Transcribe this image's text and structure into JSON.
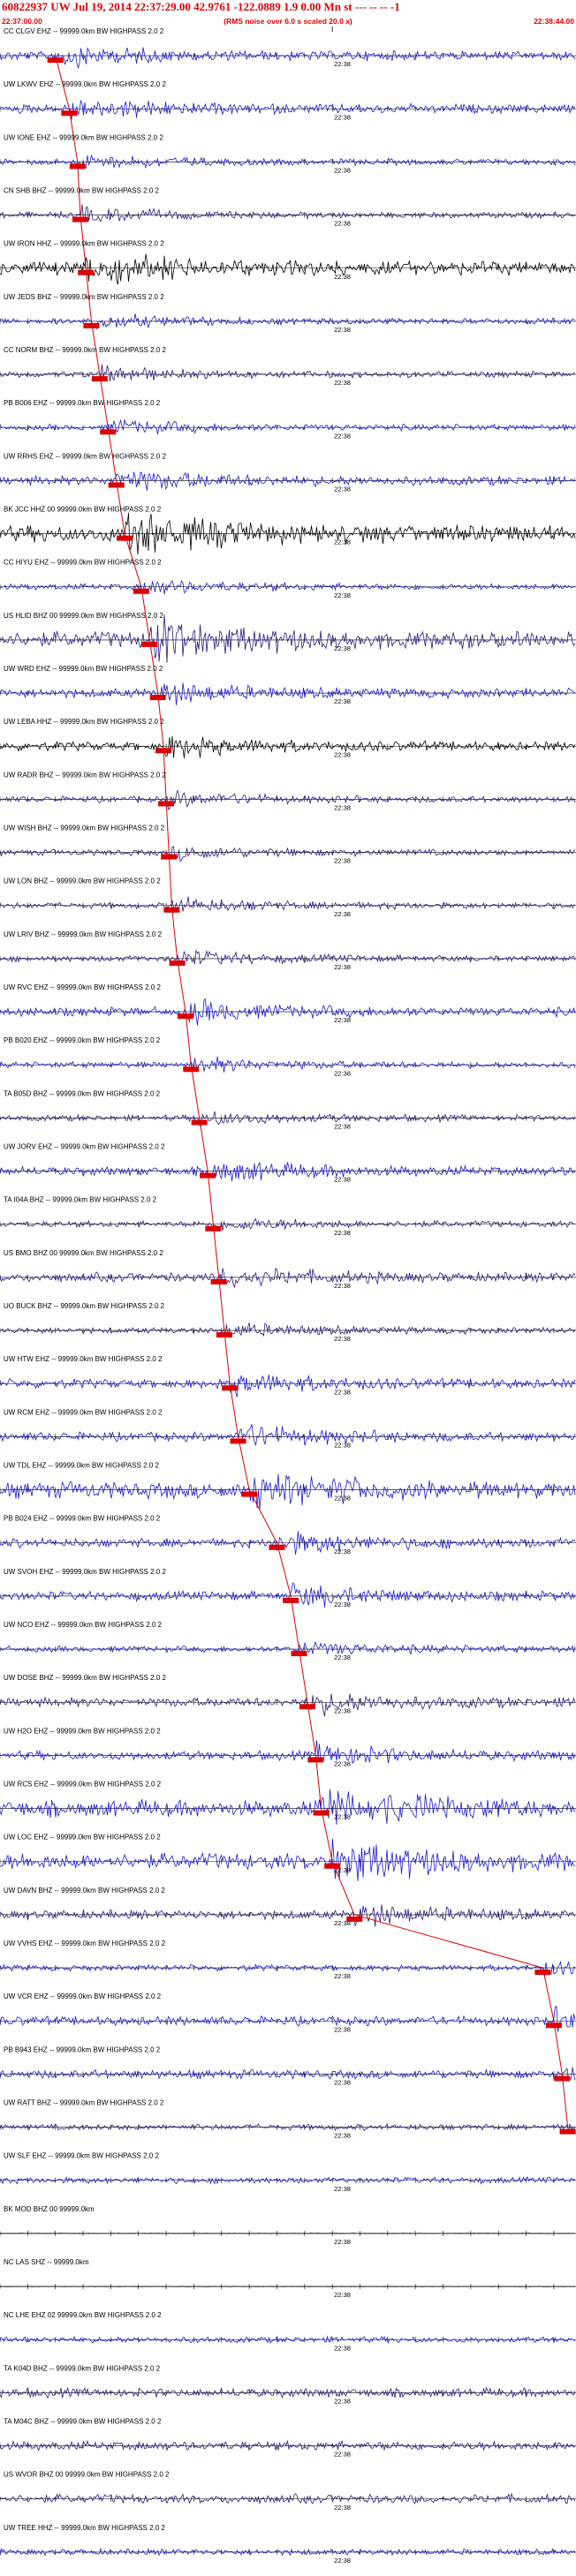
{
  "header": {
    "title": "60822937 UW Jul 19, 2014 22:37:29.00   42.9761 -122.0889  1.9 0.00 Mn st --- -- --   -1",
    "subtitle": "(RMS noise over 6.0 s scaled 20.0 x)",
    "start_time": "22:37:00.00",
    "end_time": "22:38:44.00"
  },
  "chart_data": {
    "type": "line",
    "title": "60822937 UW Jul 19, 2014 22:37:29.00   42.9761 -122.0889  1.9 0.00 Mn st --- -- --   -1",
    "xlabel": "",
    "ylabel": "",
    "time_start": "22:37:00.00",
    "time_end": "22:38:44.00",
    "time_range_s": [
      0,
      104
    ],
    "minute_mark": "22:38",
    "minute_mark_s": 60,
    "tick_interval_s": 5,
    "grid": false,
    "pick_color": "#dd0000",
    "series": [
      {
        "name": "CC CLGV EHZ -- 99999.0km BW  HIGHPASS  2.0  2",
        "color": "#1a1acc",
        "amplitude": "moderate",
        "pick_s": 10.0
      },
      {
        "name": "UW LKWV EHZ -- 99999.0km BW  HIGHPASS  2.0  2",
        "color": "#1a1acc",
        "amplitude": "moderate",
        "pick_s": 12.5
      },
      {
        "name": "UW IONE EHZ -- 99999.0km BW  HIGHPASS  2.0  2",
        "color": "#1a1acc",
        "amplitude": "low",
        "pick_s": 14.0
      },
      {
        "name": "CN SHB BHZ -- 99999.0km BW  HIGHPASS  2.0  2",
        "color": "#2a1a80",
        "amplitude": "low",
        "pick_s": 14.5
      },
      {
        "name": "UW IRON HHZ -- 99999.0km BW  HIGHPASS  2.0  2",
        "color": "#000000",
        "amplitude": "high",
        "pick_s": 15.5
      },
      {
        "name": "UW JEDS BHZ -- 99999.0km BW  HIGHPASS  2.0  2",
        "color": "#1a1acc",
        "amplitude": "low",
        "pick_s": 16.5
      },
      {
        "name": "CC NORM BHZ -- 99999.0km BW  HIGHPASS  2.0  2",
        "color": "#2a1a80",
        "amplitude": "low",
        "pick_s": 18.0
      },
      {
        "name": "PB B006 EHZ -- 99999.0km BW  HIGHPASS  2.0  2",
        "color": "#1a1acc",
        "amplitude": "low",
        "pick_s": 19.5
      },
      {
        "name": "UW RRHS EHZ -- 99999.0km BW  HIGHPASS  2.0  2",
        "color": "#1a1acc",
        "amplitude": "moderate",
        "pick_s": 21.0
      },
      {
        "name": "BK JCC HHZ 00 99999.0km BW  HIGHPASS  2.0  2",
        "color": "#000000",
        "amplitude": "burst",
        "pick_s": 22.5
      },
      {
        "name": "CC HIYU EHZ -- 99999.0km BW  HIGHPASS  2.0  2",
        "color": "#1a1acc",
        "amplitude": "low",
        "pick_s": 25.5
      },
      {
        "name": "US HLID BHZ 00 99999.0km BW  HIGHPASS  2.0  2",
        "color": "#2a1a80",
        "amplitude": "burst",
        "pick_s": 27.0
      },
      {
        "name": "UW WRD EHZ -- 99999.0km BW  HIGHPASS  2.0  2",
        "color": "#1a1acc",
        "amplitude": "moderate",
        "pick_s": 28.5
      },
      {
        "name": "UW LEBA HHZ -- 99999.0km BW  HIGHPASS  2.0  2",
        "color": "#000000",
        "amplitude": "moderate",
        "pick_s": 29.5
      },
      {
        "name": "UW RADR BHZ -- 99999.0km BW  HIGHPASS  2.0  2",
        "color": "#2a1a80",
        "amplitude": "low",
        "pick_s": 30.0
      },
      {
        "name": "UW WISH BHZ -- 99999.0km BW  HIGHPASS  2.0  2",
        "color": "#2a1a80",
        "amplitude": "low",
        "pick_s": 30.5
      },
      {
        "name": "UW LON BHZ -- 99999.0km BW  HIGHPASS  2.0  2",
        "color": "#2a1a80",
        "amplitude": "low",
        "pick_s": 31.0
      },
      {
        "name": "UW LRIV BHZ -- 99999.0km BW  HIGHPASS  2.0  2",
        "color": "#2a1a80",
        "amplitude": "low",
        "pick_s": 32.0
      },
      {
        "name": "UW RVC EHZ -- 99999.0km BW  HIGHPASS  2.0  2",
        "color": "#1a1acc",
        "amplitude": "moderate",
        "pick_s": 33.5
      },
      {
        "name": "PB B020 EHZ -- 99999.0km BW  HIGHPASS  2.0  2",
        "color": "#1a1acc",
        "amplitude": "low",
        "pick_s": 34.5
      },
      {
        "name": "TA B05D BHZ -- 99999.0km BW  HIGHPASS  2.0  2",
        "color": "#2a1a80",
        "amplitude": "low",
        "pick_s": 36.0
      },
      {
        "name": "UW JORV EHZ -- 99999.0km BW  HIGHPASS  2.0  2",
        "color": "#1a1acc",
        "amplitude": "moderate",
        "pick_s": 37.5
      },
      {
        "name": "TA I04A BHZ -- 99999.0km BW  HIGHPASS  2.0  2",
        "color": "#2a1a80",
        "amplitude": "low",
        "pick_s": 38.5
      },
      {
        "name": "US BMO BHZ 00 99999.0km BW  HIGHPASS  2.0  2",
        "color": "#2a1a80",
        "amplitude": "moderate",
        "pick_s": 39.5
      },
      {
        "name": "UO BUCK BHZ -- 99999.0km BW  HIGHPASS  2.0  2",
        "color": "#2a1a80",
        "amplitude": "low",
        "pick_s": 40.5
      },
      {
        "name": "UW HTW EHZ -- 99999.0km BW  HIGHPASS  2.0  2",
        "color": "#1a1acc",
        "amplitude": "moderate",
        "pick_s": 41.5
      },
      {
        "name": "UW RCM EHZ -- 99999.0km BW  HIGHPASS  2.0  2",
        "color": "#1a1acc",
        "amplitude": "moderate",
        "pick_s": 43.0
      },
      {
        "name": "UW TDL EHZ -- 99999.0km BW  HIGHPASS  2.0  2",
        "color": "#1a1acc",
        "amplitude": "burst",
        "pick_s": 45.0
      },
      {
        "name": "PB B024 EHZ -- 99999.0km BW  HIGHPASS  2.0  2",
        "color": "#1a1acc",
        "amplitude": "moderate",
        "pick_s": 50.0
      },
      {
        "name": "UW SVOH EHZ -- 99999.0km BW  HIGHPASS  2.0  2",
        "color": "#1a1acc",
        "amplitude": "moderate",
        "pick_s": 52.5
      },
      {
        "name": "UW NCO EHZ -- 99999.0km BW  HIGHPASS  2.0  2",
        "color": "#1a1acc",
        "amplitude": "low",
        "pick_s": 54.0
      },
      {
        "name": "UW DOSE BHZ -- 99999.0km BW  HIGHPASS  2.0  2",
        "color": "#2a1a80",
        "amplitude": "moderate",
        "pick_s": 55.5
      },
      {
        "name": "UW H2O EHZ -- 99999.0km BW  HIGHPASS  2.0  2",
        "color": "#1a1acc",
        "amplitude": "moderate",
        "pick_s": 57.0
      },
      {
        "name": "UW RCS EHZ -- 99999.0km BW  HIGHPASS  2.0  2",
        "color": "#1a1acc",
        "amplitude": "burst",
        "pick_s": 58.0
      },
      {
        "name": "UW LOC EHZ -- 99999.0km BW  HIGHPASS  2.0  2",
        "color": "#1a1acc",
        "amplitude": "burst",
        "pick_s": 60.0
      },
      {
        "name": "UW DAVN BHZ -- 99999.0km BW  HIGHPASS  2.0  2",
        "color": "#2a1a80",
        "amplitude": "moderate",
        "pick_s": 64.0
      },
      {
        "name": "UW VVHS EHZ -- 99999.0km BW  HIGHPASS  2.0  2",
        "color": "#1a1acc",
        "amplitude": "low",
        "pick_s": 98.0
      },
      {
        "name": "UW VCR EHZ -- 99999.0km BW  HIGHPASS  2.0  2",
        "color": "#1a1acc",
        "amplitude": "moderate",
        "pick_s": 100.0
      },
      {
        "name": "PB B943 EHZ -- 99999.0km BW  HIGHPASS  2.0  2",
        "color": "#1a1acc",
        "amplitude": "moderate",
        "pick_s": 101.5
      },
      {
        "name": "UW RATT BHZ -- 99999.0km BW  HIGHPASS  2.0  2",
        "color": "#2a1a80",
        "amplitude": "low",
        "pick_s": 102.5
      },
      {
        "name": "UW SLF EHZ -- 99999.0km BW  HIGHPASS  2.0  2",
        "color": "#1a1acc",
        "amplitude": "low",
        "pick_s": null
      },
      {
        "name": "BK MOD BHZ 00 99999.0km",
        "color": "#000000",
        "amplitude": "flat",
        "pick_s": null
      },
      {
        "name": "NC LAS SHZ -- 99999.0km",
        "color": "#000000",
        "amplitude": "flat",
        "pick_s": null
      },
      {
        "name": "NC LHE EHZ 02 99999.0km BW  HIGHPASS  2.0  2",
        "color": "#1a1acc",
        "amplitude": "low",
        "pick_s": null
      },
      {
        "name": "TA K04D BHZ -- 99999.0km BW  HIGHPASS  2.0  2",
        "color": "#2a1a80",
        "amplitude": "moderate",
        "pick_s": null
      },
      {
        "name": "TA M04C BHZ -- 99999.0km BW  HIGHPASS  2.0  2",
        "color": "#2a1a80",
        "amplitude": "moderate",
        "pick_s": null
      },
      {
        "name": "US WVOR BHZ 00 99999.0km BW  HIGHPASS  2.0  2",
        "color": "#2a1a80",
        "amplitude": "moderate",
        "pick_s": null
      },
      {
        "name": "UW TREE HHZ -- 99999.0km BW  HIGHPASS  2.0  2",
        "color": "#1a1acc",
        "amplitude": "low",
        "pick_s": null
      }
    ]
  }
}
